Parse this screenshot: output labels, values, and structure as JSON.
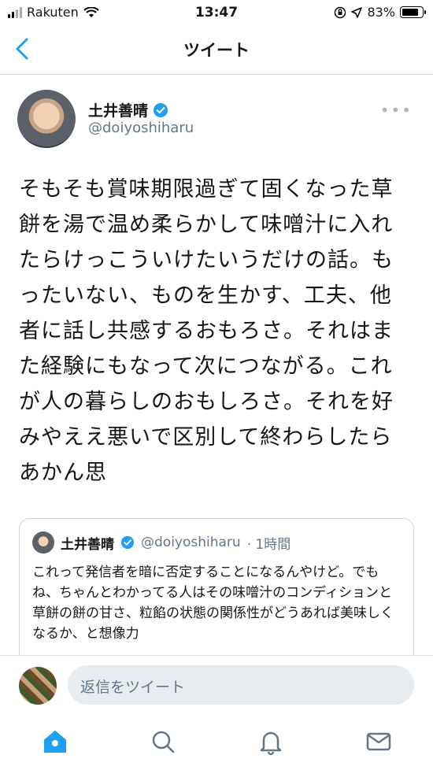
{
  "status_bar": {
    "carrier": "Rakuten",
    "time": "13:47",
    "battery": "83%"
  },
  "nav": {
    "title": "ツイート"
  },
  "tweet": {
    "author_name": "土井善晴",
    "author_handle": "@doiyoshiharu",
    "text": "そもそも賞味期限過ぎて固くなった草餅を湯で温め柔らかして味噌汁に入れたらけっこういけたいうだけの話。もったいない、ものを生かす、工夫、他者に話し共感するおもろさ。それはまた経験にもなって次につながる。これが人の暮らしのおもしろさ。それを好みやええ悪いで区別して終わらしたらあかん思"
  },
  "quote": {
    "author_name": "土井善晴",
    "author_handle": "@doiyoshiharu",
    "time": "· 1時間",
    "text": "これって発信者を暗に否定することになるんやけど。でもね、ちゃんとわかってる人はその味噌汁のコンディションと草餅の餅の甘さ、粒餡の状態の関係性がどうあれば美味しくなるか、と想像力"
  },
  "reply": {
    "placeholder": "返信をツイート"
  },
  "colors": {
    "accent": "#1da1f2",
    "muted": "#657786",
    "border": "#ccd6dd"
  },
  "icons": [
    "signal-icon",
    "wifi-icon",
    "orientation-lock-icon",
    "location-icon",
    "battery-icon",
    "back-chevron-icon",
    "verified-badge-icon",
    "more-options-icon",
    "home-icon",
    "search-icon",
    "notifications-icon",
    "messages-icon"
  ]
}
